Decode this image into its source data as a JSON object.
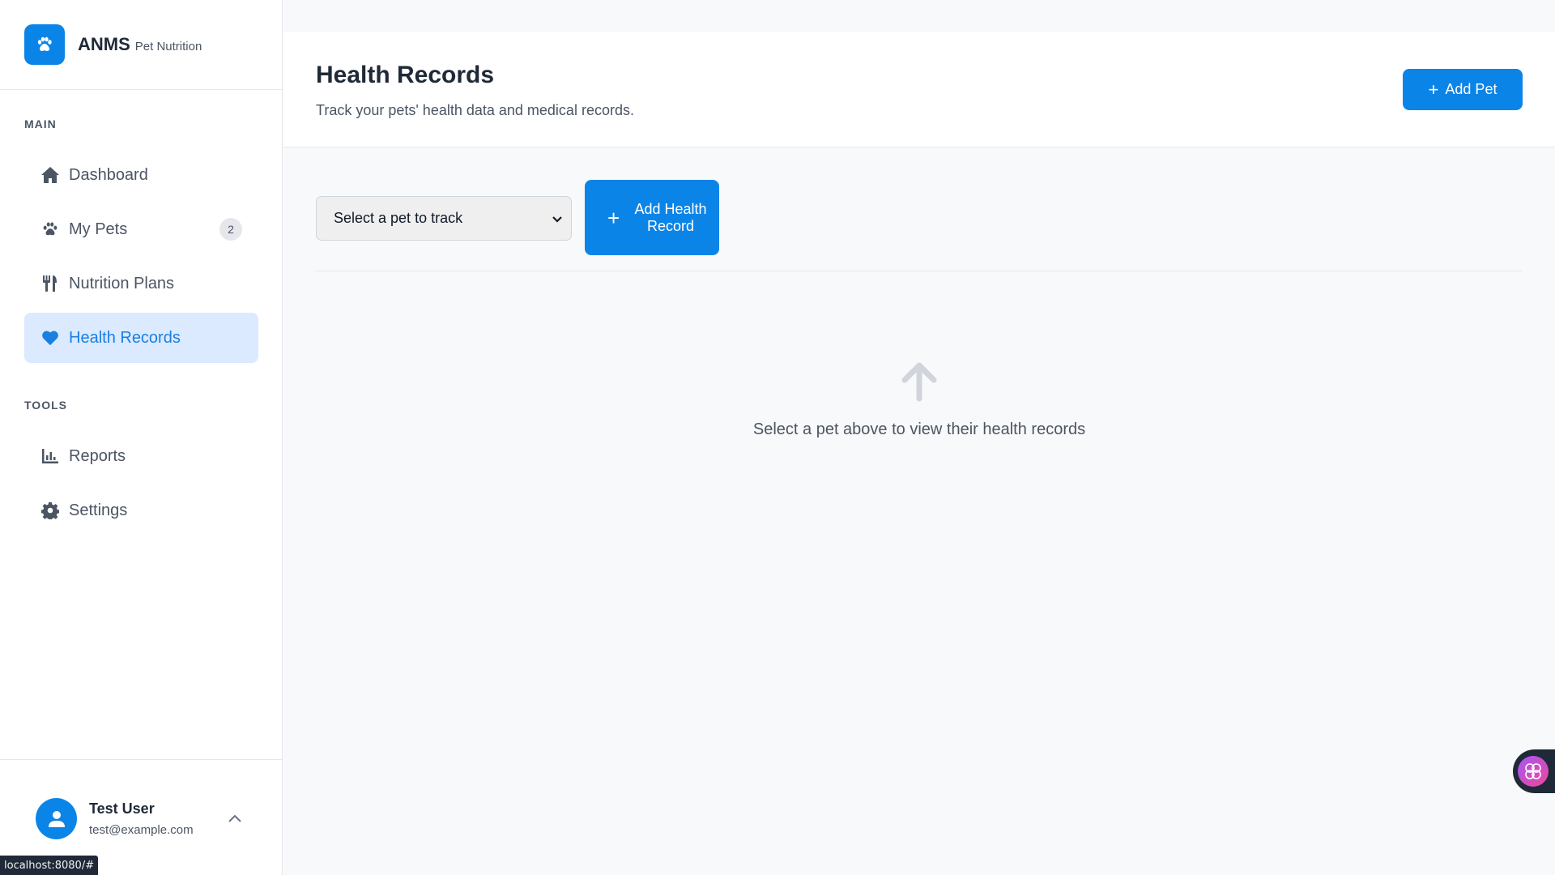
{
  "brand": {
    "name": "ANMS",
    "subtitle": "Pet Nutrition"
  },
  "sidebar": {
    "sections": [
      {
        "label": "MAIN"
      },
      {
        "label": "TOOLS"
      }
    ],
    "items": [
      {
        "label": "Dashboard",
        "icon": "home-icon"
      },
      {
        "label": "My Pets",
        "icon": "paw-icon",
        "badge": "2"
      },
      {
        "label": "Nutrition Plans",
        "icon": "utensils-icon"
      },
      {
        "label": "Health Records",
        "icon": "heart-icon",
        "active": true
      },
      {
        "label": "Reports",
        "icon": "chart-icon"
      },
      {
        "label": "Settings",
        "icon": "gear-icon"
      }
    ]
  },
  "user": {
    "name": "Test User",
    "email": "test@example.com"
  },
  "header": {
    "title": "Health Records",
    "subtitle": "Track your pets' health data and medical records.",
    "add_pet_label": "Add Pet"
  },
  "controls": {
    "select_value": "Select a pet to track",
    "add_record_label": "Add Health Record"
  },
  "empty_state": {
    "message": "Select a pet above to view their health records"
  },
  "status_bar": {
    "url": "localhost:8080/#"
  },
  "colors": {
    "accent": "#0b84e8",
    "active_bg": "#dbeafe",
    "active_text": "#1a7fe0"
  }
}
